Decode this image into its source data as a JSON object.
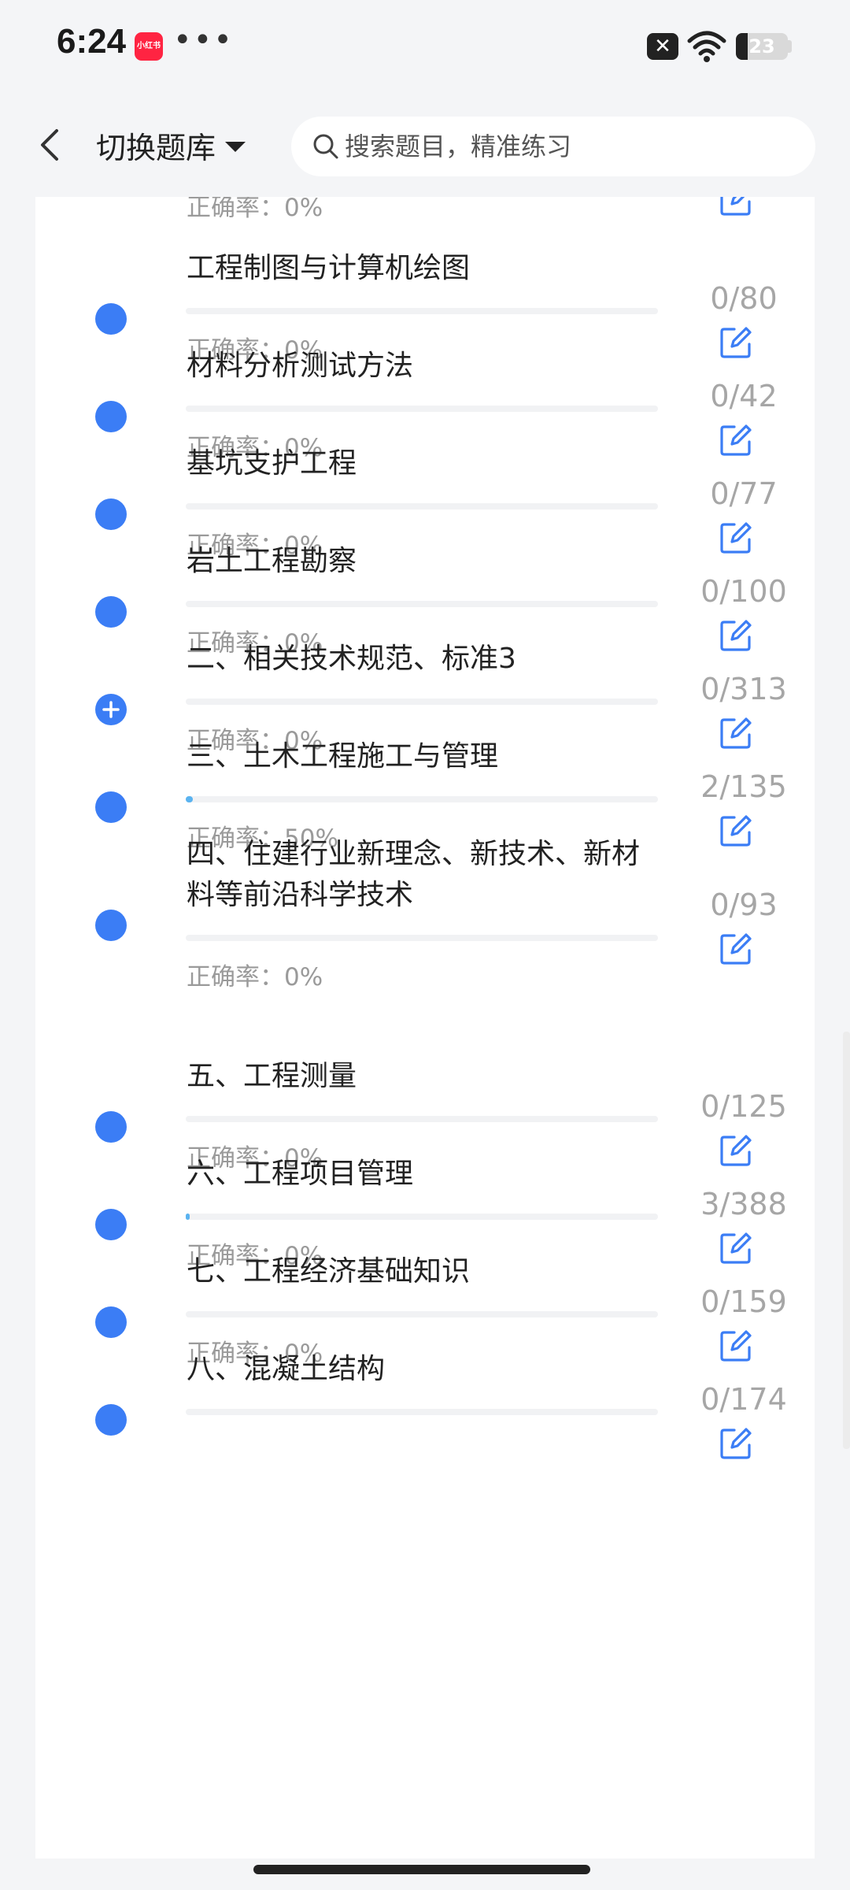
{
  "status": {
    "time": "6:24",
    "app_icon_text": "小红书",
    "battery": "23",
    "battery_level": 0.23
  },
  "header": {
    "bank_label": "切换题库",
    "search_placeholder": "搜索题目，精准练习"
  },
  "list": {
    "rate_label": "正确率：",
    "items": [
      {
        "title": "",
        "count": "",
        "rate": "0%",
        "progress": 0,
        "icon": "dot"
      },
      {
        "title": "工程制图与计算机绘图",
        "count": "0/80",
        "rate": "0%",
        "progress": 0,
        "icon": "dot"
      },
      {
        "title": "材料分析测试方法",
        "count": "0/42",
        "rate": "0%",
        "progress": 0,
        "icon": "dot"
      },
      {
        "title": "基坑支护工程",
        "count": "0/77",
        "rate": "0%",
        "progress": 0,
        "icon": "dot"
      },
      {
        "title": "岩土工程勘察",
        "count": "0/100",
        "rate": "0%",
        "progress": 0,
        "icon": "dot"
      },
      {
        "title": "二、相关技术规范、标准3",
        "count": "0/313",
        "rate": "0%",
        "progress": 0,
        "icon": "plus"
      },
      {
        "title": "三、土木工程施工与管理",
        "count": "2/135",
        "rate": "50%",
        "progress": 0.0148,
        "icon": "dot"
      },
      {
        "title": "四、住建行业新理念、新技术、新材料等前沿科学技术",
        "count": "0/93",
        "rate": "0%",
        "progress": 0,
        "icon": "dot"
      },
      {
        "title": "五、工程测量",
        "count": "0/125",
        "rate": "0%",
        "progress": 0,
        "icon": "dot"
      },
      {
        "title": "六、工程项目管理",
        "count": "3/388",
        "rate": "0%",
        "progress": 0.0077,
        "icon": "dot"
      },
      {
        "title": "七、工程经济基础知识",
        "count": "0/159",
        "rate": "0%",
        "progress": 0,
        "icon": "dot"
      },
      {
        "title": "八、混凝土结构",
        "count": "0/174",
        "rate": "",
        "progress": 0,
        "icon": "dot"
      }
    ]
  },
  "colors": {
    "accent": "#3b7df5",
    "progress": "#5ab3f0",
    "muted": "#9a9a9a"
  }
}
